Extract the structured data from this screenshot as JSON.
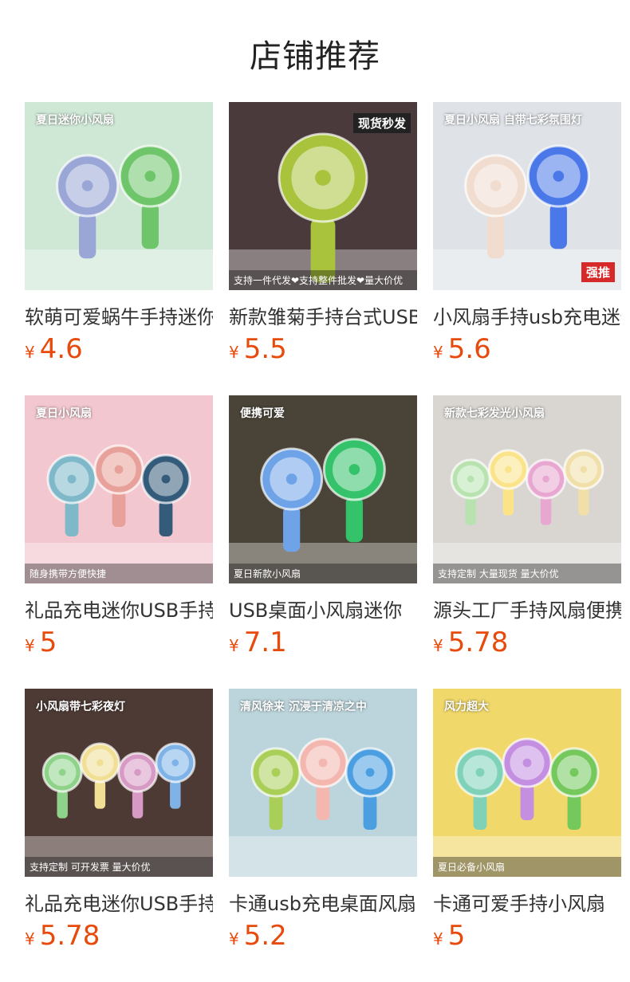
{
  "page": {
    "title": "店铺推荐"
  },
  "currency_symbol": "¥",
  "products": [
    {
      "name": "软萌可爱蜗牛手持迷你",
      "price": "4.6",
      "image": {
        "overlay_top": "夏日迷你小风扇",
        "overlay_badge": "",
        "overlay_bottom": "",
        "bg": "#cfe8d6",
        "fan_colors": [
          "#9aa6d6",
          "#6ec56a"
        ]
      }
    },
    {
      "name": "新款雏菊手持台式USB",
      "price": "5.5",
      "image": {
        "overlay_top": "",
        "overlay_badge": "现货秒发",
        "overlay_bottom": "支持一件代发❤支持整件批发❤量大价优",
        "bg": "#4a3a3c",
        "fan_colors": [
          "#a9c43c"
        ]
      }
    },
    {
      "name": "小风扇手持usb充电迷你",
      "price": "5.6",
      "image": {
        "overlay_top": "夏日小风扇 自带七彩氛围灯",
        "overlay_badge": "强推",
        "overlay_bottom": "",
        "bg": "#dfe3e8",
        "fan_colors": [
          "#f1dcd0",
          "#4a78e8"
        ]
      }
    },
    {
      "name": "礼品充电迷你USB手持",
      "price": "5",
      "image": {
        "overlay_top": "夏日小风扇",
        "overlay_badge": "",
        "overlay_bottom": "随身携带方便快捷",
        "bg": "#f3c7cf",
        "fan_colors": [
          "#7fb8c8",
          "#e7a19a",
          "#355b7a"
        ]
      }
    },
    {
      "name": "USB桌面小风扇迷你",
      "price": "7.1",
      "image": {
        "overlay_top": "便携可爱",
        "overlay_badge": "",
        "overlay_bottom": "夏日新款小风扇",
        "bg": "#4a4438",
        "fan_colors": [
          "#6fa3e8",
          "#34c26a"
        ]
      }
    },
    {
      "name": "源头工厂手持风扇便携",
      "price": "5.78",
      "image": {
        "overlay_top": "新款七彩发光小风扇",
        "overlay_badge": "",
        "overlay_bottom": "支持定制 大量现货 量大价优",
        "bg": "#d9d6d2",
        "fan_colors": [
          "#b8e3b0",
          "#fbe38a",
          "#e7a7d0",
          "#f0dfa8"
        ]
      }
    },
    {
      "name": "礼品充电迷你USB手持",
      "price": "5.78",
      "image": {
        "overlay_top": "小风扇带七彩夜灯",
        "overlay_badge": "",
        "overlay_bottom": "支持定制 可开发票 量大价优",
        "bg": "#4d3a35",
        "fan_colors": [
          "#8fd38a",
          "#f1df95",
          "#d79ac5",
          "#7fb3e8"
        ]
      }
    },
    {
      "name": "卡通usb充电桌面风扇",
      "price": "5.2",
      "image": {
        "overlay_top": "清风徐来 沉浸于清凉之中",
        "overlay_badge": "",
        "overlay_bottom": "",
        "bg": "#bcd5dc",
        "fan_colors": [
          "#a9cf58",
          "#f3b7b0",
          "#4b9fe0"
        ]
      }
    },
    {
      "name": "卡通可爱手持小风扇",
      "price": "5",
      "image": {
        "overlay_top": "风力超大",
        "overlay_badge": "",
        "overlay_bottom": "夏日必备小风扇",
        "bg": "#f0d86a",
        "fan_colors": [
          "#7fd2b8",
          "#c48fe0",
          "#74c85c"
        ]
      }
    }
  ]
}
